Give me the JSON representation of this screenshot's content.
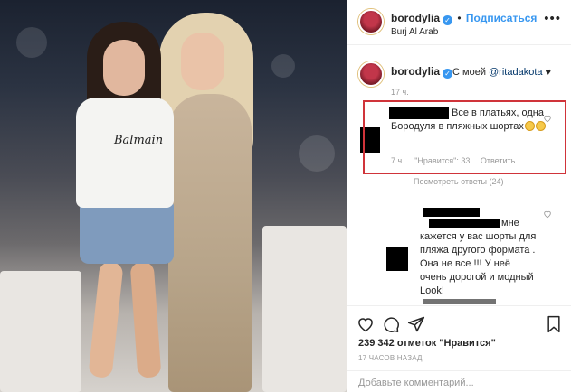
{
  "post": {
    "username": "borodylia",
    "follow_label": "Подписаться",
    "location": "Burj Al Arab",
    "more_icon": "more-horizontal-icon",
    "photo_shirt_text": "Balmain"
  },
  "caption": {
    "username": "borodylia",
    "text_before": "С моей ",
    "mention": "@ritadakota",
    "text_after": " ♥",
    "time": "17 ч."
  },
  "highlighted_comment": {
    "text": "Все в платьях, одна Бородуля в пляжных шортах",
    "time": "7 ч.",
    "likes_label": "\"Нравится\": 33",
    "reply_label": "Ответить",
    "view_replies": "Посмотреть ответы (24)"
  },
  "reply_comment": {
    "text": "мне кажется у вас шорты для пляжа другого формата . Она не все !!! У неё очень дорогой и модный Look!"
  },
  "stats": {
    "likes": "239 342 отметок \"Нравится\"",
    "posted": "17 ЧАСОВ НАЗАД"
  },
  "composer": {
    "placeholder": "Добавьте комментарий..."
  },
  "colors": {
    "link_blue": "#3897f0",
    "highlight_red": "#d0343a",
    "meta_gray": "#999999",
    "text_dark": "#262626"
  }
}
